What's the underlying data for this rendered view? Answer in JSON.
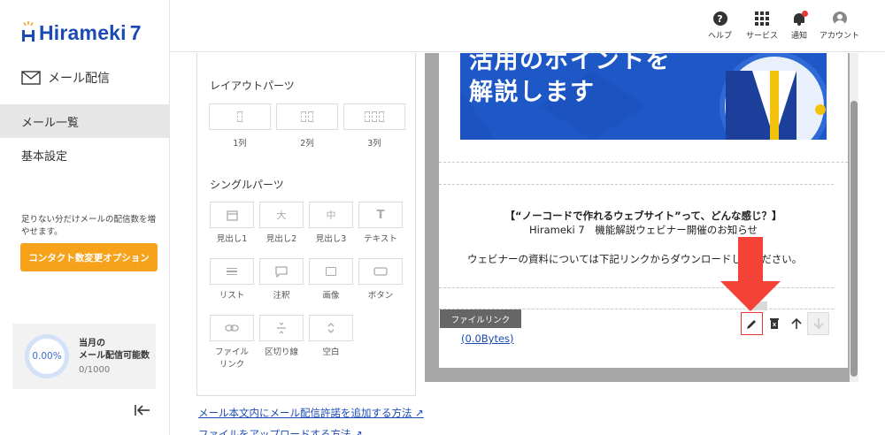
{
  "app": {
    "logo_text": "Hirameki",
    "logo_version": "7"
  },
  "sidebar": {
    "section_label": "メール配信",
    "items": [
      {
        "label": "メール一覧",
        "active": true
      },
      {
        "label": "基本設定",
        "active": false
      }
    ],
    "upsell_note": "足りない分だけメールの配信数を増やせます。",
    "upsell_button": "コンタクト数変更オプション",
    "quota": {
      "percent": "0.00%",
      "title_line1": "当月の",
      "title_line2": "メール配信可能数",
      "count": "0/1000"
    }
  },
  "topbar": {
    "buttons": [
      {
        "label": "ヘルプ",
        "icon": "help-circle-icon"
      },
      {
        "label": "サービス",
        "icon": "apps-grid-icon"
      },
      {
        "label": "通知",
        "icon": "bell-icon"
      },
      {
        "label": "アカウント",
        "icon": "account-icon"
      }
    ]
  },
  "parts_panel": {
    "layout_title": "レイアウトパーツ",
    "layout_items": [
      {
        "label": "1列"
      },
      {
        "label": "2列"
      },
      {
        "label": "3列"
      }
    ],
    "single_title": "シングルパーツ",
    "single_items": [
      {
        "label": "見出し1",
        "glyph": ""
      },
      {
        "label": "見出し2",
        "glyph": "大"
      },
      {
        "label": "見出し3",
        "glyph": "中"
      },
      {
        "label": "テキスト",
        "glyph": "T"
      },
      {
        "label": "リスト",
        "glyph": ""
      },
      {
        "label": "注釈",
        "glyph": ""
      },
      {
        "label": "画像",
        "glyph": ""
      },
      {
        "label": "ボタン",
        "glyph": ""
      },
      {
        "label": "ファイル\nリンク",
        "glyph": ""
      },
      {
        "label": "区切り線",
        "glyph": ""
      },
      {
        "label": "空白",
        "glyph": ""
      }
    ]
  },
  "links": {
    "add_permission": "メール本文内にメール配信許諾を追加する方法",
    "upload_file": "ファイルをアップロードする方法"
  },
  "preview": {
    "banner_line1": "活用のポイントを",
    "banner_line2": "解説します",
    "heading": "【“ノーコードで作れるウェブサイト”って、どんな感じ？】",
    "subheading": "Hirameki 7　機能解説ウェビナー開催のお知らせ",
    "body": "ウェビナーの資料については下記リンクからダウンロードしてください。",
    "file_tag": "ファイルリンク",
    "file_size": "(0.0Bytes)"
  },
  "colors": {
    "brand": "#1a4bb5",
    "accent_orange": "#f7a21b",
    "highlight_red": "#e53935",
    "banner_blue": "#1e58c7"
  }
}
